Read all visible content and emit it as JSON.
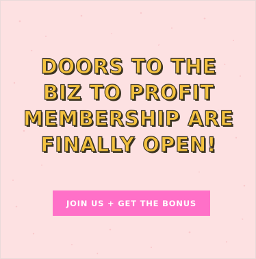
{
  "promo": {
    "headline_lines": [
      "DOORS TO THE",
      "BIZ TO PROFIT",
      "MEMBERSHIP ARE",
      "FINALLY OPEN!"
    ],
    "cta_label": "JOIN US + GET THE BONUS"
  },
  "colors": {
    "background": "#fde1e2",
    "headline_fill": "#f4c23f",
    "headline_outline": "#3a3322",
    "cta_background": "#ff70c8",
    "cta_text": "#ffffff"
  }
}
